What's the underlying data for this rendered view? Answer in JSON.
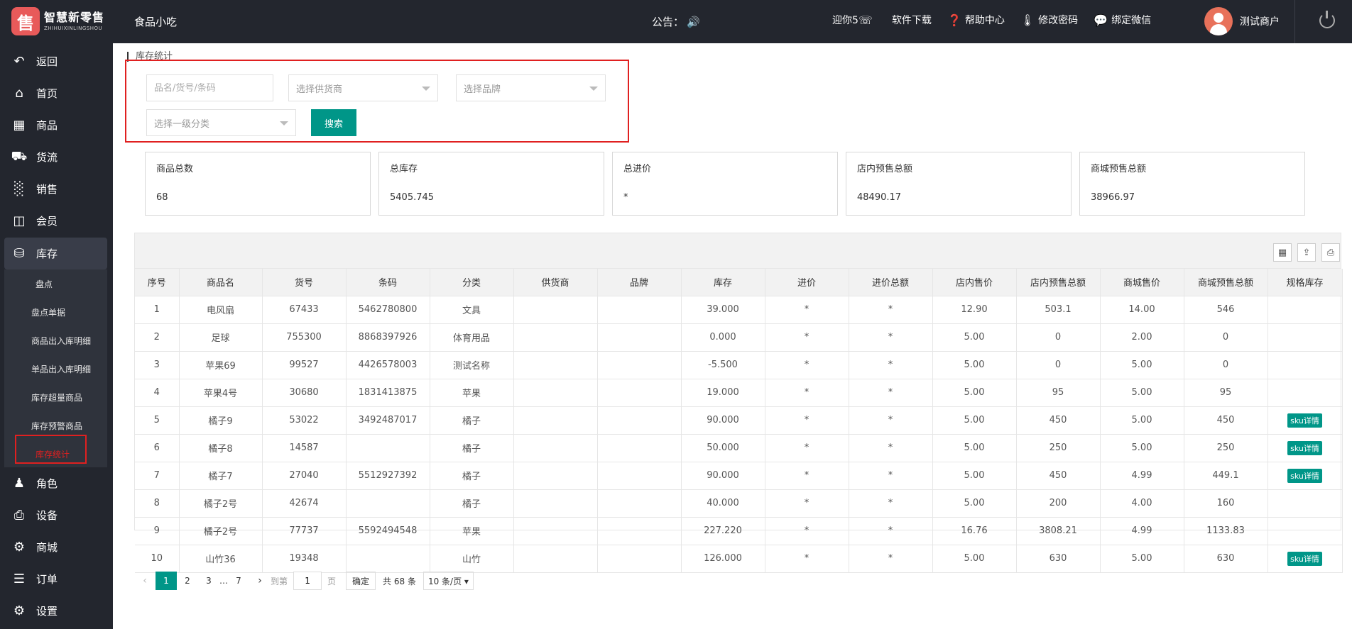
{
  "header": {
    "logo_mark": "售",
    "logo_cn": "智慧新零售",
    "logo_en": "ZHIHUIXINLINGSHOU",
    "shop_name": "食品小吃",
    "notice_label": "公告：",
    "links": [
      {
        "label": "迎你5",
        "icon": "phone-icon"
      },
      {
        "label": "软件下载",
        "icon": "download-icon"
      },
      {
        "label": "帮助中心",
        "icon": "help-icon"
      },
      {
        "label": "修改密码",
        "icon": "thermometer-icon"
      },
      {
        "label": "绑定微信",
        "icon": "wechat-icon"
      }
    ],
    "user_name": "测试商户"
  },
  "sidebar": {
    "items": [
      {
        "label": "返回",
        "icon": "back-icon"
      },
      {
        "label": "首页",
        "icon": "home-icon"
      },
      {
        "label": "商品",
        "icon": "grid-icon"
      },
      {
        "label": "货流",
        "icon": "truck-icon"
      },
      {
        "label": "销售",
        "icon": "bar-chart-icon"
      },
      {
        "label": "会员",
        "icon": "member-card-icon"
      },
      {
        "label": "库存",
        "icon": "database-icon"
      },
      {
        "label": "角色",
        "icon": "user-icon"
      },
      {
        "label": "设备",
        "icon": "printer-icon"
      },
      {
        "label": "商城",
        "icon": "gear-icon"
      },
      {
        "label": "订单",
        "icon": "list-icon"
      },
      {
        "label": "设置",
        "icon": "settings-icon"
      }
    ],
    "sub_items": [
      "盘点",
      "盘点单据",
      "商品出入库明细",
      "单品出入库明细",
      "库存超量商品",
      "库存预警商品",
      "库存统计"
    ],
    "active_sub": "库存统计",
    "colors": {
      "bg": "#23262e",
      "active_text": "#e02020"
    }
  },
  "page": {
    "title": "库存统计",
    "filters": {
      "keyword_placeholder": "品名/货号/条码",
      "supplier_placeholder": "选择供货商",
      "brand_placeholder": "选择品牌",
      "category_placeholder": "选择一级分类",
      "search_label": "搜索"
    },
    "stats": [
      {
        "label": "商品总数",
        "value": "68"
      },
      {
        "label": "总库存",
        "value": "5405.745"
      },
      {
        "label": "总进价",
        "value": "*"
      },
      {
        "label": "店内预售总额",
        "value": "48490.17"
      },
      {
        "label": "商城预售总额",
        "value": "38966.97"
      }
    ]
  },
  "table": {
    "columns": [
      "序号",
      "商品名",
      "货号",
      "条码",
      "分类",
      "供货商",
      "品牌",
      "库存",
      "进价",
      "进价总额",
      "店内售价",
      "店内预售总额",
      "商城售价",
      "商城预售总额",
      "规格库存"
    ],
    "sku_label": "sku详情",
    "rows": [
      {
        "no": "1",
        "name": "电风扇",
        "code": "67433",
        "barcode": "5462780800",
        "category": "文具",
        "supplier": "",
        "brand": "",
        "stock": "39.000",
        "cost": "*",
        "cost_total": "*",
        "store_price": "12.90",
        "store_total": "503.1",
        "mall_price": "14.00",
        "mall_total": "546",
        "sku": ""
      },
      {
        "no": "2",
        "name": "足球",
        "code": "755300",
        "barcode": "8868397926",
        "category": "体育用品",
        "supplier": "",
        "brand": "",
        "stock": "0.000",
        "cost": "*",
        "cost_total": "*",
        "store_price": "5.00",
        "store_total": "0",
        "mall_price": "2.00",
        "mall_total": "0",
        "sku": ""
      },
      {
        "no": "3",
        "name": "苹果69",
        "code": "99527",
        "barcode": "4426578003",
        "category": "测试名称",
        "supplier": "",
        "brand": "",
        "stock": "-5.500",
        "cost": "*",
        "cost_total": "*",
        "store_price": "5.00",
        "store_total": "0",
        "mall_price": "5.00",
        "mall_total": "0",
        "sku": ""
      },
      {
        "no": "4",
        "name": "苹果4号",
        "code": "30680",
        "barcode": "1831413875",
        "category": "苹果",
        "supplier": "",
        "brand": "",
        "stock": "19.000",
        "cost": "*",
        "cost_total": "*",
        "store_price": "5.00",
        "store_total": "95",
        "mall_price": "5.00",
        "mall_total": "95",
        "sku": ""
      },
      {
        "no": "5",
        "name": "橘子9",
        "code": "53022",
        "barcode": "3492487017",
        "category": "橘子",
        "supplier": "",
        "brand": "",
        "stock": "90.000",
        "cost": "*",
        "cost_total": "*",
        "store_price": "5.00",
        "store_total": "450",
        "mall_price": "5.00",
        "mall_total": "450",
        "sku": "sku详情"
      },
      {
        "no": "6",
        "name": "橘子8",
        "code": "14587",
        "barcode": "",
        "category": "橘子",
        "supplier": "",
        "brand": "",
        "stock": "50.000",
        "cost": "*",
        "cost_total": "*",
        "store_price": "5.00",
        "store_total": "250",
        "mall_price": "5.00",
        "mall_total": "250",
        "sku": "sku详情"
      },
      {
        "no": "7",
        "name": "橘子7",
        "code": "27040",
        "barcode": "5512927392",
        "category": "橘子",
        "supplier": "",
        "brand": "",
        "stock": "90.000",
        "cost": "*",
        "cost_total": "*",
        "store_price": "5.00",
        "store_total": "450",
        "mall_price": "4.99",
        "mall_total": "449.1",
        "sku": "sku详情"
      },
      {
        "no": "8",
        "name": "橘子2号",
        "code": "42674",
        "barcode": "",
        "category": "橘子",
        "supplier": "",
        "brand": "",
        "stock": "40.000",
        "cost": "*",
        "cost_total": "*",
        "store_price": "5.00",
        "store_total": "200",
        "mall_price": "4.00",
        "mall_total": "160",
        "sku": ""
      },
      {
        "no": "9",
        "name": "橘子2号",
        "code": "77737",
        "barcode": "5592494548",
        "category": "苹果",
        "supplier": "",
        "brand": "",
        "stock": "227.220",
        "cost": "*",
        "cost_total": "*",
        "store_price": "16.76",
        "store_total": "3808.21",
        "mall_price": "4.99",
        "mall_total": "1133.83",
        "sku": ""
      },
      {
        "no": "10",
        "name": "山竹36",
        "code": "19348",
        "barcode": "",
        "category": "山竹",
        "supplier": "",
        "brand": "",
        "stock": "126.000",
        "cost": "*",
        "cost_total": "*",
        "store_price": "5.00",
        "store_total": "630",
        "mall_price": "5.00",
        "mall_total": "630",
        "sku": "sku详情"
      }
    ]
  },
  "pager": {
    "pages": [
      "1",
      "2",
      "3",
      "…",
      "7"
    ],
    "current": "1",
    "goto_label": "到第",
    "goto_value": "1",
    "page_unit": "页",
    "confirm_label": "确定",
    "total_label": "共 68 条",
    "size_label": "10 条/页 ▾"
  }
}
